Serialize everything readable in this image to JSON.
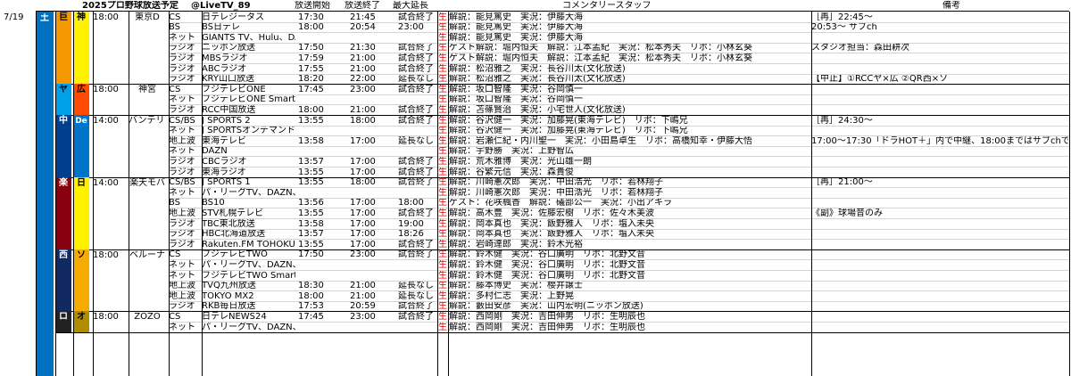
{
  "header": {
    "title": "2025プロ野球放送予定",
    "account": "@LiveTV_89",
    "col_start": "放送開始",
    "col_end": "放送終了",
    "col_ext": "最大延長",
    "col_staff": "コメンタリースタッフ",
    "col_note": "備考"
  },
  "date": "7/19",
  "weekday": "土",
  "games": [
    {
      "home": "巨",
      "away": "神",
      "time": "18:00",
      "venue": "東京D",
      "home_color": "#f39800",
      "away_color": "#fff100",
      "home_text": "#000000",
      "away_text": "#000000",
      "rows": [
        {
          "type": "CS",
          "ch": "日テレジータス",
          "start": "17:30",
          "end": "21:45",
          "ext": "試合終了",
          "live": "生",
          "staff": "解説：能見篤史　実況：伊藤大海",
          "note": "［再］22:45～"
        },
        {
          "type": "BS",
          "ch": "BS日テレ",
          "start": "18:00",
          "end": "20:54",
          "ext": "23:00",
          "live": "生",
          "staff": "解説：能見篤史　実況：伊藤大海",
          "note": "20:53～ サブch"
        },
        {
          "type": "ネット",
          "ch": "GIANTS TV、Hulu、DAZN、虎テレ",
          "start": "",
          "end": "",
          "ext": "",
          "live": "生",
          "staff": "解説：能見篤史　実況：伊藤大海",
          "note": ""
        },
        {
          "type": "ラジオ",
          "ch": "ニッポン放送",
          "start": "17:50",
          "end": "21:30",
          "ext": "試合終了",
          "live": "生",
          "staff": "ゲスト解説：堀内恒夫　解説：江本孟紀　実況：松本秀夫　リポ：小林玄葵",
          "note": "スタジオ担当：森田耕次"
        },
        {
          "type": "ラジオ",
          "ch": "MBSラジオ",
          "start": "17:59",
          "end": "21:00",
          "ext": "試合終了",
          "live": "生",
          "staff": "ゲスト解説：堀内恒夫　解説：江本孟紀　実況：松本秀夫　リポ：小林玄葵",
          "note": ""
        },
        {
          "type": "ラジオ",
          "ch": "ABCラジオ",
          "start": "17:55",
          "end": "21:00",
          "ext": "試合終了",
          "live": "生",
          "staff": "解説：松沼雅之　実況：長谷川太(文化放送)",
          "note": ""
        },
        {
          "type": "ラジオ",
          "ch": "KRY山口放送",
          "start": "18:20",
          "end": "22:00",
          "ext": "延長なし",
          "live": "生",
          "staff": "解説：松沼雅之　実況：長谷川太(文化放送)",
          "note": "【中止】①RCCヤ×広 ②QR西×ソ"
        }
      ]
    },
    {
      "home": "ヤ",
      "away": "広",
      "time": "18:00",
      "venue": "神宮",
      "home_color": "#00a0e9",
      "away_color": "#ff4b00",
      "home_text": "#000000",
      "away_text": "#000000",
      "rows": [
        {
          "type": "CS",
          "ch": "フジテレビONE",
          "start": "17:45",
          "end": "23:00",
          "ext": "試合終了",
          "live": "生",
          "staff": "解説：坂口智隆　実況：谷岡慎一",
          "note": ""
        },
        {
          "type": "ネット",
          "ch": "フジテレビONE Smart、FOD、DAZN",
          "start": "",
          "end": "",
          "ext": "",
          "live": "生",
          "staff": "解説：坂口智隆　実況：谷岡慎一",
          "note": ""
        },
        {
          "type": "ラジオ",
          "ch": "RCC中国放送",
          "start": "18:00",
          "end": "21:00",
          "ext": "試合終了",
          "live": "生",
          "staff": "解説：苫篠賢治　実況：小宅世人(文化放送)",
          "note": ""
        }
      ]
    },
    {
      "home": "中",
      "away": "De",
      "time": "14:00",
      "venue": "バンテリン",
      "home_color": "#003f8e",
      "away_color": "#0074c8",
      "home_text": "#ffffff",
      "away_text": "#ffffff",
      "rows": [
        {
          "type": "CS/BS",
          "ch": "J SPORTS 2",
          "start": "13:55",
          "end": "18:00",
          "ext": "試合終了",
          "live": "生",
          "staff": "解説：谷沢健一　実況：加藤晃(東海テレビ)　リポ：下嶋兄",
          "note": "［再］24:30～"
        },
        {
          "type": "ネット",
          "ch": "J SPORTSオンデマンド",
          "start": "",
          "end": "",
          "ext": "",
          "live": "生",
          "staff": "解説：谷沢健一　実況：加藤晃(東海テレビ)　リポ：下嶋兄",
          "note": ""
        },
        {
          "type": "地上波",
          "ch": "東海テレビ",
          "start": "13:58",
          "end": "17:00",
          "ext": "延長なし",
          "live": "生",
          "staff": "解説：岩瀬仁紀・内川聖一　実況：小田島卓生　リポ：高橋知幸・伊藤大悟",
          "note": "17:00～17:30「ドラHOT＋」内で中継、18:00まではサブchで放送"
        },
        {
          "type": "ネット",
          "ch": "DAZN",
          "start": "",
          "end": "",
          "ext": "",
          "live": "生",
          "staff": "解説：宇野勝　実況：上野智広",
          "note": ""
        },
        {
          "type": "ラジオ",
          "ch": "CBCラジオ",
          "start": "13:57",
          "end": "17:00",
          "ext": "試合終了",
          "live": "生",
          "staff": "解説：荒木雅博　実況：光山雄一朗",
          "note": ""
        },
        {
          "type": "ラジオ",
          "ch": "東海ラジオ",
          "start": "13:55",
          "end": "17:00",
          "ext": "試合終了",
          "live": "生",
          "staff": "解説：谷繁元信　実況：森貴俊",
          "note": ""
        }
      ]
    },
    {
      "home": "楽",
      "away": "日",
      "time": "14:00",
      "venue": "楽天モバ",
      "home_color": "#860010",
      "away_color": "#fff100",
      "home_text": "#ffffff",
      "away_text": "#000000",
      "rows": [
        {
          "type": "CS/BS",
          "ch": "J SPORTS 1",
          "start": "13:55",
          "end": "18:00",
          "ext": "試合終了",
          "live": "生",
          "staff": "解説：川崎憲次郎　実況：中田浩光　リポ：若林翔子",
          "note": "［再］21:00～"
        },
        {
          "type": "ネット",
          "ch": "パ・リーグTV、DAZN、Rakuten TV、ベースボールLIVE",
          "start": "",
          "end": "",
          "ext": "",
          "live": "生",
          "staff": "解説：川崎憲次郎　実況：中田浩光　リポ：若林翔子",
          "note": ""
        },
        {
          "type": "BS",
          "ch": "BS10",
          "start": "13:56",
          "end": "17:00",
          "ext": "18:00",
          "live": "生",
          "staff": "ゲスト：花咲楓香　解説：礒部公一　実況：小出アキラ",
          "note": ""
        },
        {
          "type": "地上波",
          "ch": "STV札幌テレビ",
          "start": "13:55",
          "end": "17:00",
          "ext": "試合終了",
          "live": "生",
          "staff": "解説：高木豊　実況：佐藤宏樹　リポ：佐々木美波",
          "note": "《副》球場音のみ"
        },
        {
          "type": "ラジオ",
          "ch": "TBC東北放送",
          "start": "13:58",
          "end": "17:00",
          "ext": "19:00",
          "live": "生",
          "staff": "解説：岡本真也　実況：飯野雅人　リポ：塩入未央",
          "note": ""
        },
        {
          "type": "ラジオ",
          "ch": "HBC北海道放送",
          "start": "13:57",
          "end": "17:00",
          "ext": "18:26",
          "live": "生",
          "staff": "解説：岡本真也　実況：飯野雅人　リポ：塩入未央",
          "note": ""
        },
        {
          "type": "ラジオ",
          "ch": "Rakuten.FM TOHOKU",
          "start": "13:55",
          "end": "17:00",
          "ext": "試合終了",
          "live": "生",
          "staff": "解説：岩崎達郎　実況：鈴木光裕",
          "note": ""
        }
      ]
    },
    {
      "home": "西",
      "away": "ソ",
      "time": "18:00",
      "venue": "ベルーナ",
      "home_color": "#102961",
      "away_color": "#f6ab00",
      "home_text": "#ffffff",
      "away_text": "#000000",
      "rows": [
        {
          "type": "CS",
          "ch": "フジテレビTWO",
          "start": "17:50",
          "end": "23:00",
          "ext": "試合終了",
          "live": "生",
          "staff": "解説：鈴木健　実況：谷口廣明　リポ：北野文音",
          "note": ""
        },
        {
          "type": "ネット",
          "ch": "パ・リーグTV、DAZN、Rakuten TV、ベースボールLIVE",
          "start": "",
          "end": "",
          "ext": "",
          "live": "生",
          "staff": "解説：鈴木健　実況：谷口廣明　リポ：北野文音",
          "note": ""
        },
        {
          "type": "ネット",
          "ch": "フジテレビTWO Smart",
          "start": "",
          "end": "",
          "ext": "",
          "live": "生",
          "staff": "解説：鈴木健　実況：谷口廣明　リポ：北野文音",
          "note": ""
        },
        {
          "type": "地上波",
          "ch": "TVQ九州放送",
          "start": "18:30",
          "end": "21:00",
          "ext": "延長なし",
          "live": "生",
          "staff": "解説：藤本博史　実況：櫻井譲士",
          "note": ""
        },
        {
          "type": "地上波",
          "ch": "TOKYO MX2",
          "start": "18:00",
          "end": "21:00",
          "ext": "延長なし",
          "live": "生",
          "staff": "解説：多村仁志　実況：上野晃",
          "note": ""
        },
        {
          "type": "ラジオ",
          "ch": "RKB毎日放送",
          "start": "17:53",
          "end": "20:59",
          "ext": "試合終了",
          "live": "生",
          "staff": "解説：藪田安彦　実況：山内宏明(ニッポン放送)",
          "note": ""
        }
      ]
    },
    {
      "home": "ロ",
      "away": "オ",
      "time": "18:00",
      "venue": "ZOZO",
      "home_color": "#222222",
      "away_color": "#b08d00",
      "home_text": "#ffffff",
      "away_text": "#000000",
      "rows": [
        {
          "type": "CS",
          "ch": "日テレNEWS24",
          "start": "17:45",
          "end": "23:00",
          "ext": "試合終了",
          "live": "生",
          "staff": "解説：西岡剛　実況：吉田伸男　リポ：生明辰也",
          "note": ""
        },
        {
          "type": "ネット",
          "ch": "パ・リーグTV、DAZN、Rakuten TV、ベースボールLIVE",
          "start": "",
          "end": "",
          "ext": "",
          "live": "生",
          "staff": "解説：西岡剛　実況：吉田伸男　リポ：生明辰也",
          "note": ""
        }
      ]
    }
  ]
}
